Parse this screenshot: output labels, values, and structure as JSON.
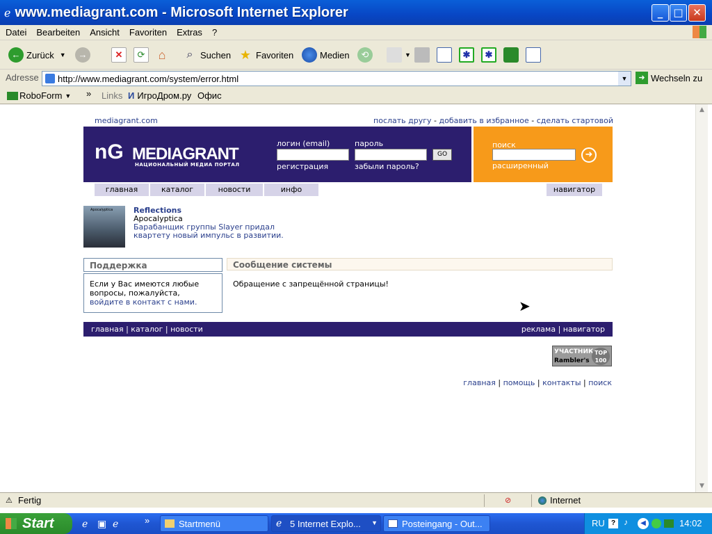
{
  "window": {
    "title": "www.mediagrant.com - Microsoft Internet Explorer"
  },
  "menu": [
    "Datei",
    "Bearbeiten",
    "Ansicht",
    "Favoriten",
    "Extras",
    "?"
  ],
  "toolbar": {
    "back": "Zurück",
    "search": "Suchen",
    "favorites": "Favoriten",
    "media": "Medien"
  },
  "address": {
    "label": "Adresse",
    "url": "http://www.mediagrant.com/system/error.html",
    "go": "Wechseln zu"
  },
  "links": {
    "roboform": "RoboForm",
    "more": "»",
    "links_label": "Links",
    "igrodrom": "ИгроДром.ру",
    "office": "Офис"
  },
  "page": {
    "top_left": "mediagrant.com",
    "top_links": [
      "послать другу",
      "добавить в избранное",
      "сделать стартовой"
    ],
    "logo_text": "MEDIAGRANT",
    "logo_sub": "НАЦИОНАЛЬНЫЙ МЕДИА ПОРТАЛ",
    "login_label": "логин (email)",
    "password_label": "пароль",
    "go_button": "GO",
    "register": "регистрация",
    "forgot": "забыли пароль?",
    "search_label": "поиск",
    "advanced": "расширенный",
    "nav": [
      "главная",
      "каталог",
      "новости",
      "инфо"
    ],
    "navigator": "навигатор",
    "feature": {
      "title": "Reflections",
      "artist": "Apocalyptica",
      "desc_line1": "Барабанщик группы Slayer придал",
      "desc_line2": "квартету новый импульс в развитии.",
      "image_caption": "Apocalyptica"
    },
    "support": {
      "title": "Поддержка",
      "text_line1": "Если у Вас имеются любые",
      "text_line2": "вопросы, пожалуйста,",
      "link": "войдите в контакт с нами."
    },
    "message": {
      "title": "Сообщение системы",
      "text": "Обращение с запрещённой страницы!"
    },
    "footer_left": [
      "главная",
      "каталог",
      "новости"
    ],
    "footer_right": [
      "реклама",
      "навигатор"
    ],
    "badge": {
      "line1": "УЧАСТНИК",
      "line2": "Rambler's",
      "top": "TOP",
      "num": "100"
    },
    "bottom_links": [
      "главная",
      "помощь",
      "контакты",
      "поиск"
    ]
  },
  "status": {
    "text": "Fertig",
    "zone": "Internet"
  },
  "taskbar": {
    "start": "Start",
    "tasks": [
      "Startmenü",
      "5 Internet Explo...",
      "Posteingang - Out..."
    ],
    "lang": "RU",
    "clock": "14:02"
  }
}
